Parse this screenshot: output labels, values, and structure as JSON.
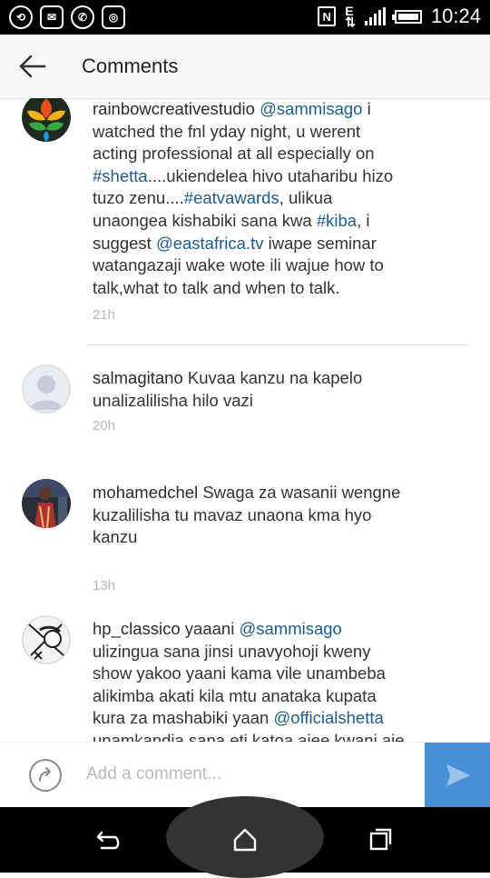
{
  "status_bar": {
    "time": "10:24",
    "network": "E"
  },
  "app_bar": {
    "title": "Comments"
  },
  "comments": [
    {
      "username": "rainbowcreativestudio",
      "lines": [
        [
          {
            "t": "mention",
            "v": "@sammisago"
          },
          {
            "t": "text",
            "v": " i"
          }
        ],
        [
          {
            "t": "text",
            "v": "watched the fnl yday night, u werent"
          }
        ],
        [
          {
            "t": "text",
            "v": "acting professional at all especially on"
          }
        ],
        [
          {
            "t": "tag",
            "v": "#shetta"
          },
          {
            "t": "text",
            "v": "....ukiendelea hivo utaharibu hizo"
          }
        ],
        [
          {
            "t": "text",
            "v": "tuzo zenu...."
          },
          {
            "t": "tag",
            "v": "#eatvawards"
          },
          {
            "t": "text",
            "v": ", ulikua"
          }
        ],
        [
          {
            "t": "text",
            "v": "unaongea kishabiki sana kwa "
          },
          {
            "t": "tag",
            "v": "#kiba"
          },
          {
            "t": "text",
            "v": ", i"
          }
        ],
        [
          {
            "t": "text",
            "v": "suggest "
          },
          {
            "t": "mention",
            "v": "@eastafrica.tv"
          },
          {
            "t": "text",
            "v": " iwape seminar"
          }
        ],
        [
          {
            "t": "text",
            "v": "watangazaji wake wote ili wajue how to"
          }
        ],
        [
          {
            "t": "text",
            "v": "talk,what to talk and when to talk."
          }
        ]
      ],
      "time": "21h"
    },
    {
      "username": "salmagitano",
      "lines": [
        [
          {
            "t": "text",
            "v": " Kuvaa kanzu na kapelo"
          }
        ],
        [
          {
            "t": "text",
            "v": "unalizalilisha hilo vazi"
          }
        ]
      ],
      "time": "20h"
    },
    {
      "username": "mohamedchel",
      "lines": [
        [
          {
            "t": "text",
            "v": " Swaga za wasanii wengne"
          }
        ],
        [
          {
            "t": "text",
            "v": "kuzalilisha tu mavaz unaona kma hyo"
          }
        ],
        [
          {
            "t": "text",
            "v": "kanzu"
          }
        ]
      ],
      "time": "13h"
    },
    {
      "username": "hp_classico",
      "lines": [
        [
          {
            "t": "text",
            "v": " yaaani "
          },
          {
            "t": "mention",
            "v": "@sammisago"
          }
        ],
        [
          {
            "t": "text",
            "v": "ulizingua sana jinsi unavyohoji kweny"
          }
        ],
        [
          {
            "t": "text",
            "v": "show yakoo yaani kama vile unambeba"
          }
        ],
        [
          {
            "t": "text",
            "v": "alikimba akati kila mtu anataka kupata"
          }
        ],
        [
          {
            "t": "text",
            "v": "kura za mashabiki yaan "
          },
          {
            "t": "mention",
            "v": "@officialshetta"
          }
        ],
        [
          {
            "t": "text",
            "v": "unamkandia sana eti katoa ajee kwani aje"
          }
        ]
      ],
      "time": ""
    }
  ],
  "comment_input": {
    "placeholder": "Add a comment..."
  },
  "colors": {
    "link": "#1e5b8c",
    "send": "#4a90d9",
    "timestamp": "#b5b5b5"
  }
}
